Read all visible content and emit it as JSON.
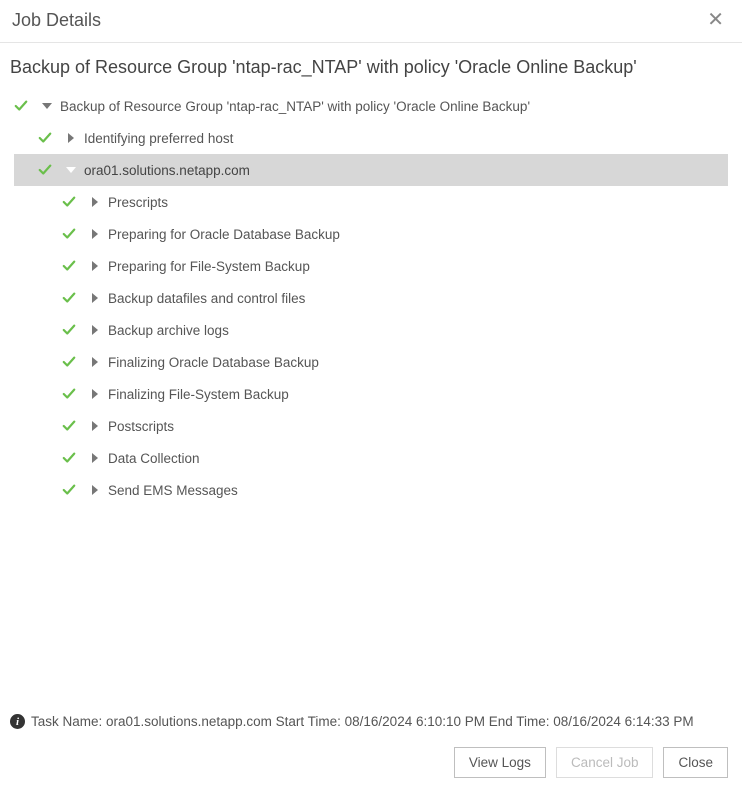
{
  "window": {
    "title": "Job Details"
  },
  "job": {
    "title": "Backup of Resource Group 'ntap-rac_NTAP' with policy 'Oracle Online Backup'"
  },
  "tree": {
    "root": {
      "label": "Backup of Resource Group 'ntap-rac_NTAP' with policy 'Oracle Online Backup'"
    },
    "identifying": "Identifying preferred host",
    "host": "ora01.solutions.netapp.com",
    "steps": [
      "Prescripts",
      "Preparing for Oracle Database Backup",
      "Preparing for File-System Backup",
      "Backup datafiles and control files",
      "Backup archive logs",
      "Finalizing Oracle Database Backup",
      "Finalizing File-System Backup",
      "Postscripts",
      "Data Collection",
      "Send EMS Messages"
    ]
  },
  "footer": {
    "task_line": "Task Name: ora01.solutions.netapp.com Start Time: 08/16/2024 6:10:10 PM End Time: 08/16/2024 6:14:33 PM"
  },
  "buttons": {
    "view_logs": "View Logs",
    "cancel_job": "Cancel Job",
    "close": "Close"
  }
}
